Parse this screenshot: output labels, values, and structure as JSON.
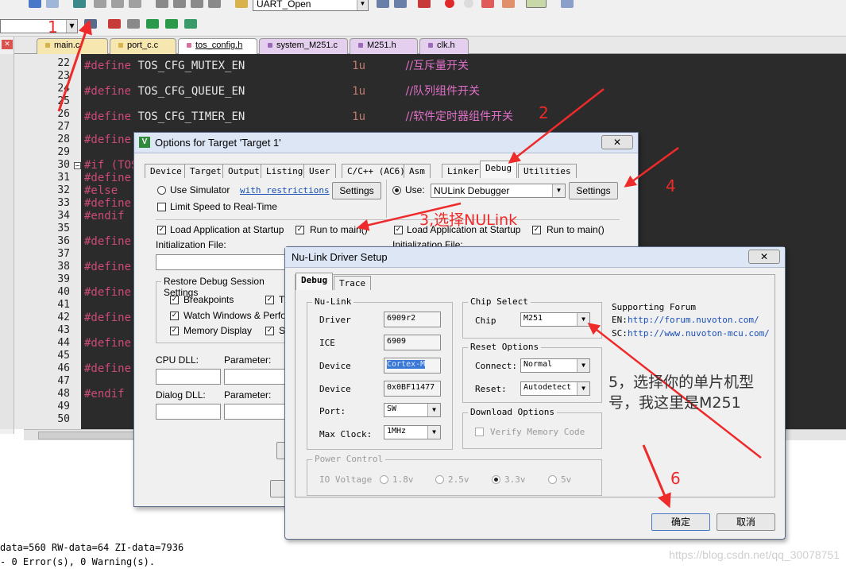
{
  "toolbar": {
    "target_combo": "UART_Open"
  },
  "editor_tabs": [
    {
      "label": "main.c",
      "color": "#f1d27a"
    },
    {
      "label": "port_c.c",
      "color": "#f1d27a"
    },
    {
      "label": "tos_config.h",
      "color": "#e7a0b8",
      "active": true
    },
    {
      "label": "system_M251.c",
      "color": "#c8a4d8"
    },
    {
      "label": "M251.h",
      "color": "#c8a4d8"
    },
    {
      "label": "clk.h",
      "color": "#c8a4d8"
    }
  ],
  "line_numbers": [
    "22",
    "23",
    "24",
    "25",
    "26",
    "27",
    "28",
    "29",
    "30",
    "31",
    "32",
    "33",
    "34",
    "35",
    "36",
    "37",
    "38",
    "39",
    "40",
    "41",
    "42",
    "43",
    "44",
    "45",
    "46",
    "47",
    "48",
    "49",
    "50"
  ],
  "code": {
    "l22": {
      "kw": "#define",
      "name": "TOS_CFG_MUTEX_EN",
      "val": "1u",
      "comment": "//互斥量开关"
    },
    "l24": {
      "kw": "#define",
      "name": "TOS_CFG_QUEUE_EN",
      "val": "1u",
      "comment": "//队列组件开关"
    },
    "l26": {
      "kw": "#define",
      "name": "TOS_CFG_TIMER_EN",
      "val": "1u",
      "comment": "//软件定时器组件开关"
    },
    "l28": "#define",
    "l30": "#if (TOS",
    "l31": "#define",
    "l32": "#else",
    "l33": "#define",
    "l34": "#endif",
    "l36": "#define",
    "l38": "#define",
    "l40": "#define",
    "l42": "#define",
    "l44": "#define",
    "l46": "#define",
    "l48": "#endif"
  },
  "build_output": {
    "line1": "data=560 RW-data=64 ZI-data=7936",
    "line2": "- 0 Error(s), 0 Warning(s)."
  },
  "options_dialog": {
    "title": "Options for Target 'Target 1'",
    "tabs": [
      "Device",
      "Target",
      "Output",
      "Listing",
      "User",
      "C/C++ (AC6)",
      "Asm",
      "Linker",
      "Debug",
      "Utilities"
    ],
    "active_tab": "Debug",
    "use_simulator": "Use Simulator",
    "with_restrictions": "with restrictions",
    "settings_left": "Settings",
    "use_label": "Use:",
    "debugger": "NULink Debugger",
    "settings_right": "Settings",
    "limit_speed": "Limit Speed to Real-Time",
    "load_app": "Load Application at Startup",
    "run_to_main": "Run to main()",
    "load_app_r": "Load Application at Startup",
    "run_to_main_r": "Run to main()",
    "init_file": "Initialization File:",
    "init_file_r": "Initialization File:",
    "restore_group": "Restore Debug Session Settings",
    "breakpoints": "Breakpoints",
    "t_label": "T",
    "watch": "Watch Windows & Performa",
    "memory": "Memory Display",
    "s_label": "S",
    "cpu_dll": "CPU DLL:",
    "param1": "Parameter:",
    "dialog_dll": "Dialog DLL:",
    "param2": "Parameter:"
  },
  "nulink_dialog": {
    "title": "Nu-Link Driver Setup",
    "tabs": [
      "Debug",
      "Trace"
    ],
    "nulink_group": "Nu-Link",
    "driver_label": "Driver",
    "driver": "6909r2",
    "ice_label": "ICE",
    "ice": "6909",
    "device_label": "Device",
    "device": "Cortex-M",
    "device2_label": "Device",
    "device2": "0x0BF11477",
    "port_label": "Port:",
    "port": "SW",
    "clock_label": "Max Clock:",
    "clock": "1MHz",
    "chip_group": "Chip Select",
    "chip_label": "Chip",
    "chip": "M251",
    "forum_label": "Supporting Forum",
    "en_label": "EN:",
    "en_url": "http://forum.nuvoton.com/",
    "sc_label": "SC:",
    "sc_url": "http://www.nuvoton-mcu.com/",
    "reset_group": "Reset Options",
    "connect_label": "Connect:",
    "connect": "Normal",
    "reset_label": "Reset:",
    "reset": "Autodetect",
    "download_group": "Download Options",
    "verify": "Verify Memory Code",
    "power_group": "Power Control",
    "io_voltage": "IO Voltage",
    "v18": "1.8v",
    "v25": "2.5v",
    "v33": "3.3v",
    "v5": "5v",
    "ok": "确定",
    "cancel": "取消"
  },
  "annotations": {
    "n1": "1",
    "n2": "2",
    "n4": "4",
    "n6": "6",
    "step3": "3,选择NULink",
    "step5_line1": "5，选择你的单片机型",
    "step5_line2": "号，我这里是M251",
    "color": "#ee2a2a"
  },
  "watermark": "https://blog.csdn.net/qq_30078751"
}
